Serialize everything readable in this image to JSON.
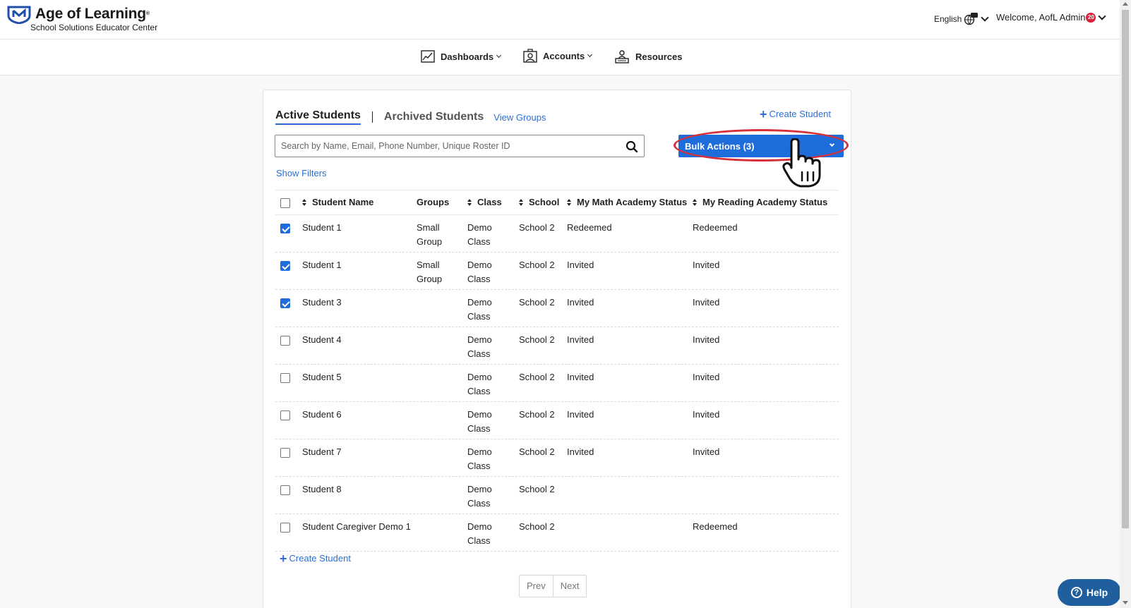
{
  "header": {
    "brand_title": "Age of Learning",
    "brand_subtitle": "School Solutions Educator Center",
    "language": "English",
    "welcome": "Welcome, AofL Admin",
    "notification_count": "20"
  },
  "nav": {
    "items": [
      {
        "label": "Dashboards",
        "icon": "chart-icon"
      },
      {
        "label": "Accounts",
        "icon": "accounts-icon"
      },
      {
        "label": "Resources",
        "icon": "resources-icon"
      }
    ]
  },
  "tabs": {
    "active": "Active Students",
    "inactive": "Archived Students",
    "view_groups": "View Groups"
  },
  "actions": {
    "create_student": "Create Student",
    "bulk_actions": "Bulk Actions (3)",
    "show_filters": "Show Filters"
  },
  "search": {
    "placeholder": "Search by Name, Email, Phone Number, Unique Roster ID"
  },
  "table": {
    "columns": [
      "Student Name",
      "Groups",
      "Class",
      "School",
      "My Math Academy Status",
      "My Reading Academy Status"
    ],
    "rows": [
      {
        "checked": true,
        "name": "Student 1",
        "group_1": "Small",
        "group_2": "Group",
        "class_1": "Demo",
        "class_2": "Class",
        "school": "School 2",
        "math": "Redeemed",
        "reading": "Redeemed"
      },
      {
        "checked": true,
        "name": "Student 1",
        "group_1": "Small",
        "group_2": "Group",
        "class_1": "Demo",
        "class_2": "Class",
        "school": "School 2",
        "math": "Invited",
        "reading": "Invited"
      },
      {
        "checked": true,
        "name": "Student 3",
        "group_1": "",
        "group_2": "",
        "class_1": "Demo",
        "class_2": "Class",
        "school": "School 2",
        "math": "Invited",
        "reading": "Invited"
      },
      {
        "checked": false,
        "name": "Student 4",
        "group_1": "",
        "group_2": "",
        "class_1": "Demo",
        "class_2": "Class",
        "school": "School 2",
        "math": "Invited",
        "reading": "Invited"
      },
      {
        "checked": false,
        "name": "Student 5",
        "group_1": "",
        "group_2": "",
        "class_1": "Demo",
        "class_2": "Class",
        "school": "School 2",
        "math": "Invited",
        "reading": "Invited"
      },
      {
        "checked": false,
        "name": "Student 6",
        "group_1": "",
        "group_2": "",
        "class_1": "Demo",
        "class_2": "Class",
        "school": "School 2",
        "math": "Invited",
        "reading": "Invited"
      },
      {
        "checked": false,
        "name": "Student 7",
        "group_1": "",
        "group_2": "",
        "class_1": "Demo",
        "class_2": "Class",
        "school": "School 2",
        "math": "Invited",
        "reading": "Invited"
      },
      {
        "checked": false,
        "name": "Student 8",
        "group_1": "",
        "group_2": "",
        "class_1": "Demo",
        "class_2": "Class",
        "school": "School 2",
        "math": "",
        "reading": ""
      },
      {
        "checked": false,
        "name": "Student Caregiver Demo 1",
        "group_1": "",
        "group_2": "",
        "class_1": "Demo",
        "class_2": "Class",
        "school": "School 2",
        "math": "",
        "reading": "Redeemed"
      }
    ]
  },
  "pagination": {
    "prev": "Prev",
    "next": "Next"
  },
  "help": {
    "label": "Help"
  },
  "colors": {
    "primary": "#1f6ddb",
    "link": "#2b6fd6",
    "highlight": "#d8303b",
    "help": "#1f5f9e"
  }
}
